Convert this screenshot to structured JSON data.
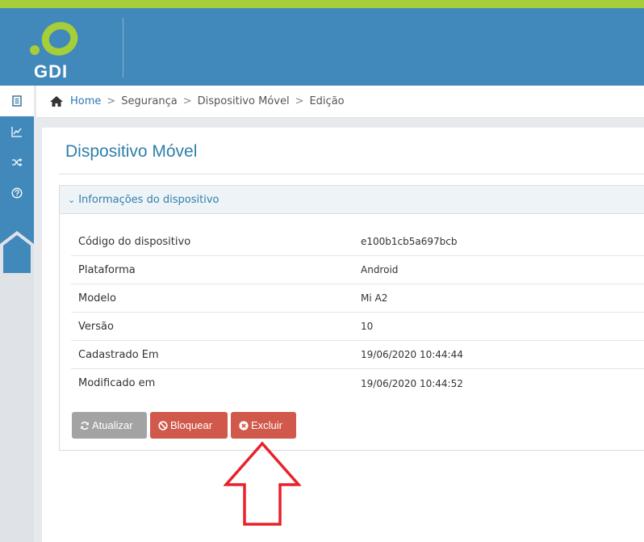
{
  "logo": {
    "text": "GDI"
  },
  "sidebar": {
    "items": [
      {
        "icon": "document-icon",
        "active": true
      },
      {
        "icon": "chart-icon",
        "active": false
      },
      {
        "icon": "shuffle-icon",
        "active": false
      },
      {
        "icon": "help-icon",
        "active": false
      }
    ]
  },
  "breadcrumb": {
    "home": "Home",
    "items": [
      "Segurança",
      "Dispositivo Móvel",
      "Edição"
    ]
  },
  "page": {
    "title": "Dispositivo Móvel"
  },
  "panel": {
    "title": "Informações do dispositivo",
    "rows": [
      {
        "label": "Código do dispositivo",
        "value": "e100b1cb5a697bcb"
      },
      {
        "label": "Plataforma",
        "value": "Android"
      },
      {
        "label": "Modelo",
        "value": "Mi A2"
      },
      {
        "label": "Versão",
        "value": "10"
      },
      {
        "label": "Cadastrado Em",
        "value": "19/06/2020 10:44:44"
      },
      {
        "label": "Modificado em",
        "value": "19/06/2020 10:44:52"
      }
    ]
  },
  "buttons": {
    "atualizar": "Atualizar",
    "bloquear": "Bloquear",
    "excluir": "Excluir"
  },
  "colors": {
    "header": "#4289bb",
    "accent_green": "#a6ce39",
    "danger": "#d1594b",
    "annotation_arrow": "#e8212a"
  }
}
